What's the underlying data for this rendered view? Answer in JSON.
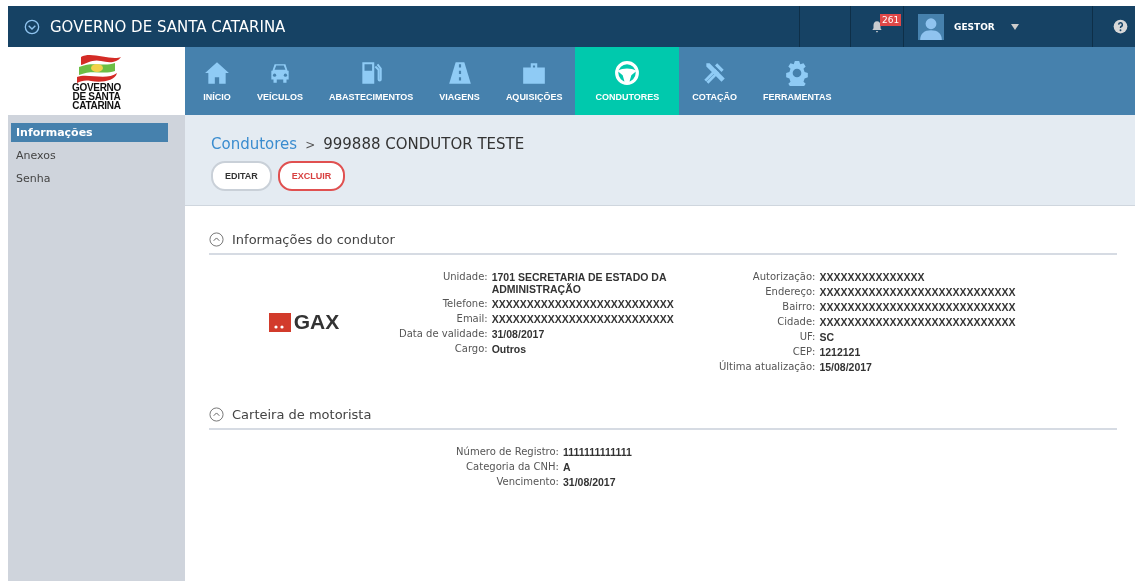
{
  "topbar": {
    "title": "GOVERNO DE SANTA CATARINA",
    "notifications": "261",
    "user": "GESTOR"
  },
  "logo": {
    "lines": [
      "GOVERNO",
      "DE SANTA",
      "CATARINA"
    ]
  },
  "nav": [
    {
      "label": "INÍCIO",
      "selected": false
    },
    {
      "label": "VEÍCULOS",
      "selected": false
    },
    {
      "label": "ABASTECIMENTOS",
      "selected": false
    },
    {
      "label": "VIAGENS",
      "selected": false
    },
    {
      "label": "AQUISIÇÕES",
      "selected": false
    },
    {
      "label": "CONDUTORES",
      "selected": true
    },
    {
      "label": "COTAÇÃO",
      "selected": false
    },
    {
      "label": "FERRAMENTAS",
      "selected": false
    }
  ],
  "sidebar": {
    "items": [
      {
        "label": "Informações",
        "selected": true
      },
      {
        "label": "Anexos",
        "selected": false
      },
      {
        "label": "Senha",
        "selected": false
      }
    ]
  },
  "header": {
    "breadcrumb_link": "Condutores",
    "separator": ">",
    "title": "999888 CONDUTOR TESTE",
    "buttons": [
      {
        "label": "EDITAR",
        "kind": "default"
      },
      {
        "label": "EXCLUIR",
        "kind": "danger"
      }
    ]
  },
  "sections": [
    {
      "title": "Informações do condutor",
      "expanded": true,
      "photo_logo": "GAX",
      "columns": [
        [
          {
            "label": "Unidade:",
            "value": "1701 SECRETARIA DE ESTADO DA ADMINISTRAÇÃO"
          },
          {
            "label": "Telefone:",
            "value": "XXXXXXXXXXXXXXXXXXXXXXXXXX"
          },
          {
            "label": "Email:",
            "value": "XXXXXXXXXXXXXXXXXXXXXXXXXX"
          },
          {
            "label": "Data de validade:",
            "value": "31/08/2017"
          },
          {
            "label": "Cargo:",
            "value": "Outros"
          }
        ],
        [
          {
            "label": "Autorização:",
            "value": "XXXXXXXXXXXXXXX"
          },
          {
            "label": "Endereço:",
            "value": "XXXXXXXXXXXXXXXXXXXXXXXXXXXX"
          },
          {
            "label": "Bairro:",
            "value": "XXXXXXXXXXXXXXXXXXXXXXXXXXXX"
          },
          {
            "label": "Cidade:",
            "value": "XXXXXXXXXXXXXXXXXXXXXXXXXXXX"
          },
          {
            "label": "UF:",
            "value": "SC"
          },
          {
            "label": "CEP:",
            "value": "1212121"
          },
          {
            "label": "Última atualização:",
            "value": "15/08/2017"
          }
        ]
      ]
    },
    {
      "title": "Carteira de motorista",
      "expanded": true,
      "columns": [
        [
          {
            "label": "Número de Registro:",
            "value": "1111111111111"
          },
          {
            "label": "Categoria da CNH:",
            "value": "A"
          },
          {
            "label": "Vencimento:",
            "value": "31/08/2017"
          }
        ]
      ]
    }
  ]
}
